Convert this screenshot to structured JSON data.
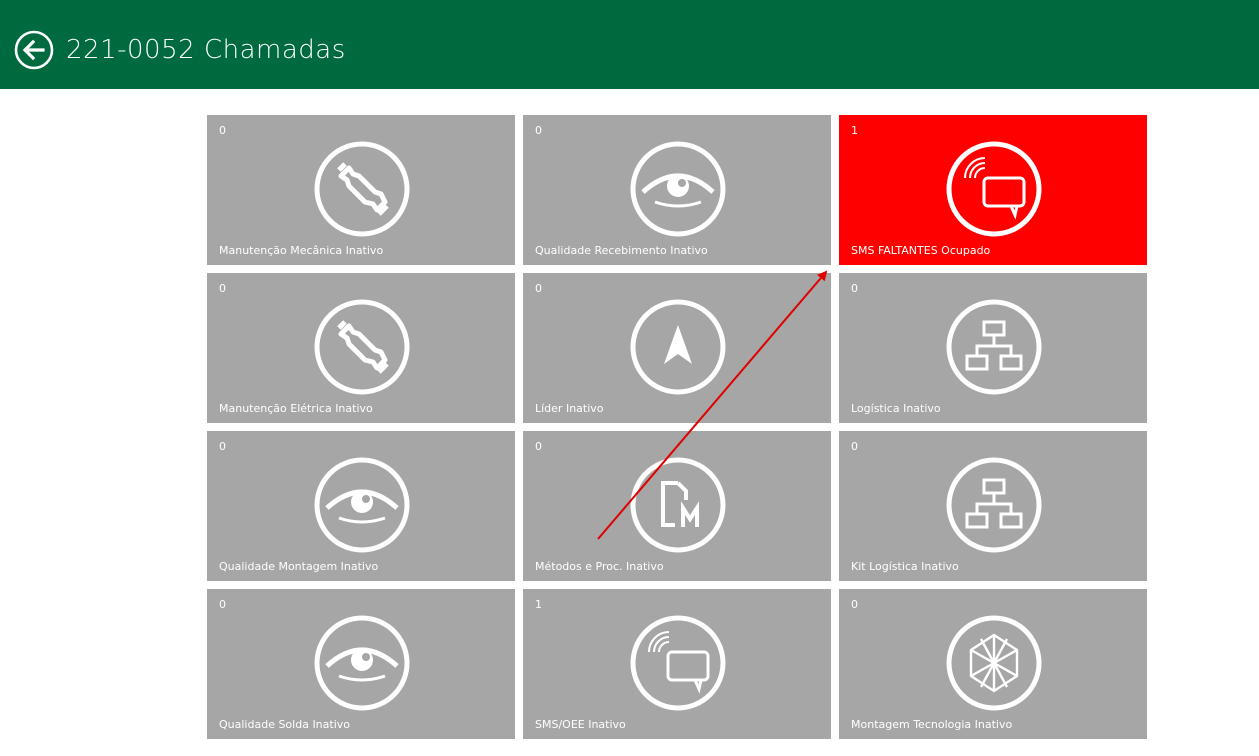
{
  "header": {
    "title": "221-0052 Chamadas"
  },
  "tiles": [
    {
      "count": "0",
      "label": "Manutenção Mecânica Inativo",
      "icon": "wrench-icon"
    },
    {
      "count": "0",
      "label": "Qualidade Recebimento Inativo",
      "icon": "eye-icon"
    },
    {
      "count": "1",
      "label": "SMS FALTANTES Ocupado",
      "icon": "chat-signal-icon"
    },
    {
      "count": "0",
      "label": "Manutenção Elétrica Inativo",
      "icon": "wrench-icon"
    },
    {
      "count": "0",
      "label": "Líder Inativo",
      "icon": "navigation-arrow-icon"
    },
    {
      "count": "0",
      "label": "Logística Inativo",
      "icon": "org-chart-icon"
    },
    {
      "count": "0",
      "label": "Qualidade Montagem Inativo",
      "icon": "eye-icon"
    },
    {
      "count": "0",
      "label": "Métodos e Proc. Inativo",
      "icon": "document-m-icon"
    },
    {
      "count": "0",
      "label": "Kit Logística Inativo",
      "icon": "org-chart-icon"
    },
    {
      "count": "0",
      "label": "Qualidade Solda Inativo",
      "icon": "eye-icon"
    },
    {
      "count": "1",
      "label": "SMS/OEE Inativo",
      "icon": "chat-signal-icon"
    },
    {
      "count": "0",
      "label": "Montagem Tecnologia Inativo",
      "icon": "network-star-icon"
    }
  ],
  "colors": {
    "header": "#006a3f",
    "tile_inactive": "#a6a6a6",
    "tile_busy": "#ff0000",
    "annotation_arrow": "#e00000"
  }
}
